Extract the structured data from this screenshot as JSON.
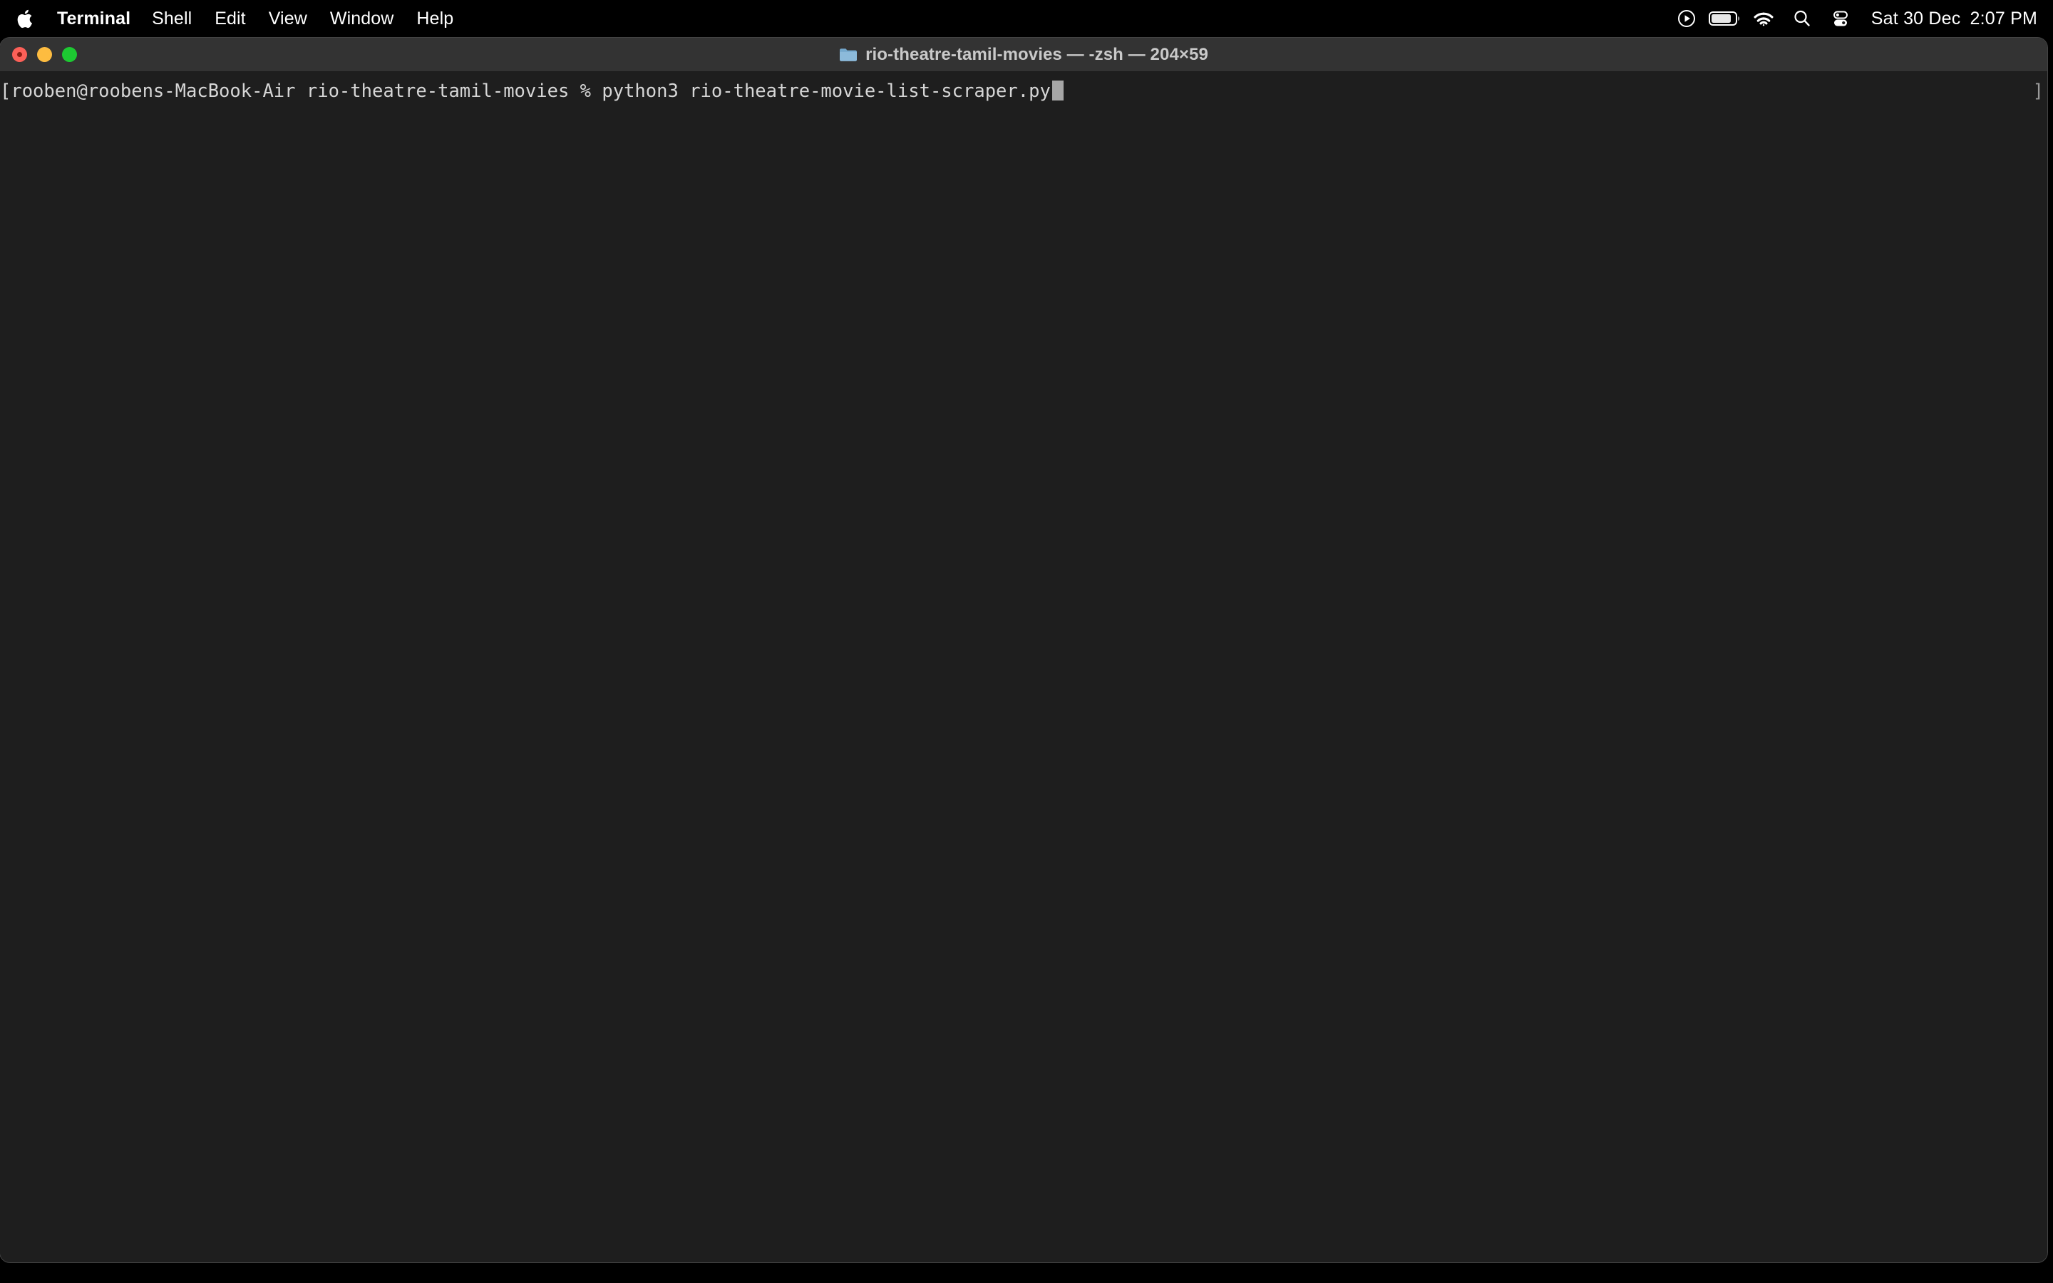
{
  "menubar": {
    "apple_icon": "apple-logo-icon",
    "items": [
      {
        "label": "Terminal",
        "bold": true
      },
      {
        "label": "Shell",
        "bold": false
      },
      {
        "label": "Edit",
        "bold": false
      },
      {
        "label": "View",
        "bold": false
      },
      {
        "label": "Window",
        "bold": false
      },
      {
        "label": "Help",
        "bold": false
      }
    ],
    "status_icons": [
      "screen-mirroring-icon",
      "battery-icon",
      "wifi-icon",
      "search-icon",
      "control-center-icon"
    ],
    "clock": {
      "date": "Sat 30 Dec",
      "time": "2:07 PM"
    }
  },
  "window": {
    "folder_icon": "folder-icon",
    "title": "rio-theatre-tamil-movies — -zsh — 204×59",
    "traffic_lights": {
      "close": "close-button",
      "minimize": "minimize-button",
      "maximize": "maximize-button"
    }
  },
  "terminal": {
    "prompt_line": "[rooben@roobens-MacBook-Air rio-theatre-tamil-movies % python3 rio-theatre-movie-list-scraper.py",
    "right_bracket": "]",
    "cursor": "block-cursor"
  },
  "colors": {
    "menubar_bg": "#000000",
    "titlebar_bg": "#333333",
    "terminal_bg": "#1e1e1e",
    "terminal_text": "#d8d8d8",
    "title_text": "#c9c9c9",
    "cursor": "#a6a6a6",
    "traffic_close": "#fc6058",
    "traffic_min": "#fdbc40",
    "traffic_max": "#1dc932",
    "folder_blue": "#6aa9d6"
  }
}
